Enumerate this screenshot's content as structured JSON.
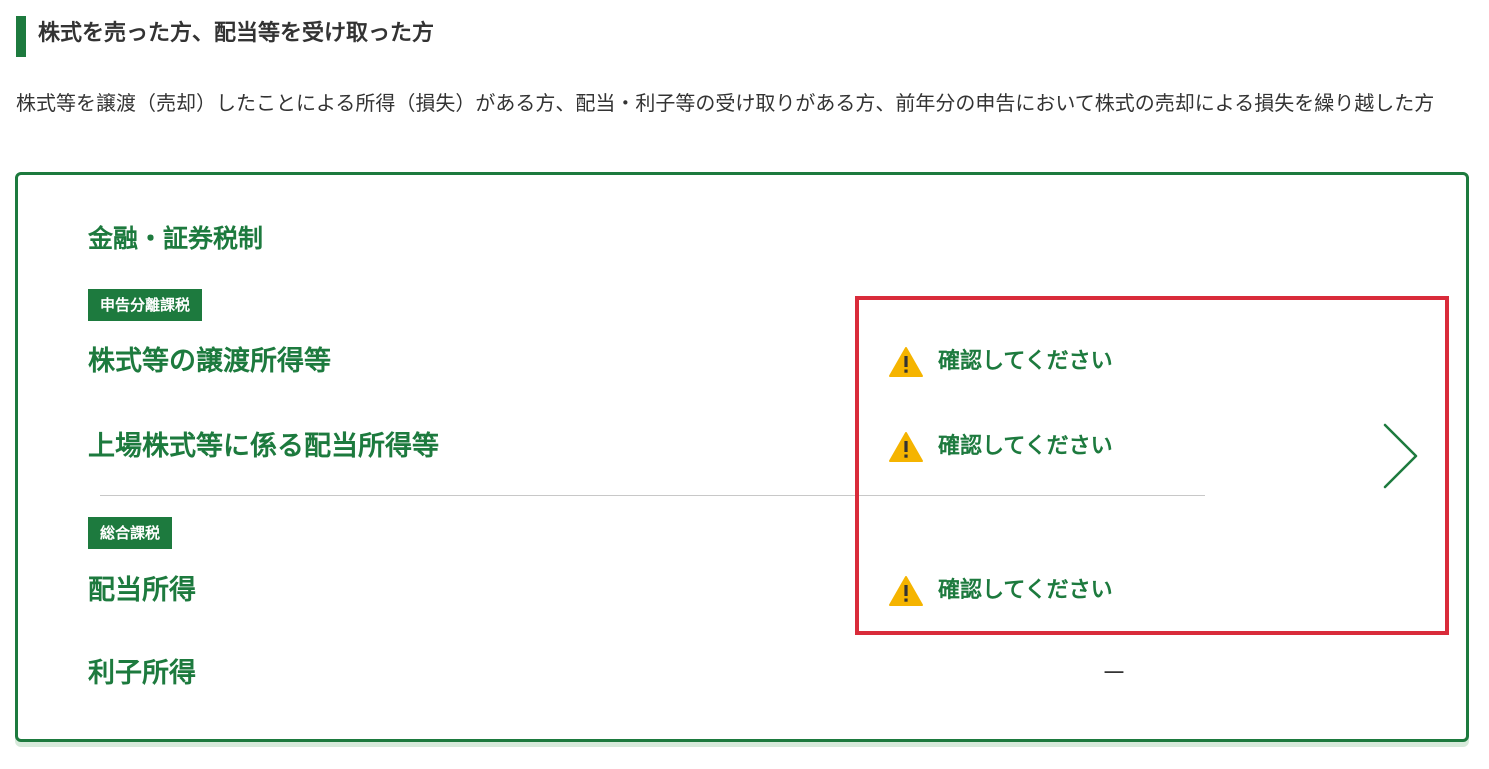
{
  "section": {
    "title": "株式を売った方、配当等を受け取った方",
    "description": "株式等を譲渡（売却）したことによる所得（損失）がある方、配当・利子等の受け取りがある方、前年分の申告において株式の売却による損失を繰り越した方"
  },
  "card": {
    "title": "金融・証券税制",
    "groups": [
      {
        "badge": "申告分離課税",
        "rows": [
          {
            "label": "株式等の譲渡所得等",
            "status": "確認してください",
            "status_icon": "warning-icon"
          },
          {
            "label": "上場株式等に係る配当所得等",
            "status": "確認してください",
            "status_icon": "warning-icon"
          }
        ]
      },
      {
        "badge": "総合課税",
        "rows": [
          {
            "label": "配当所得",
            "status": "確認してください",
            "status_icon": "warning-icon"
          },
          {
            "label": "利子所得",
            "status": "－"
          }
        ]
      }
    ],
    "nav_icon": "chevron-right-icon"
  },
  "colors": {
    "accent_green": "#1d7a3e",
    "warning_yellow": "#f5b400",
    "highlight_red": "#d92b3a",
    "card_shadow": "#d7eadb"
  }
}
